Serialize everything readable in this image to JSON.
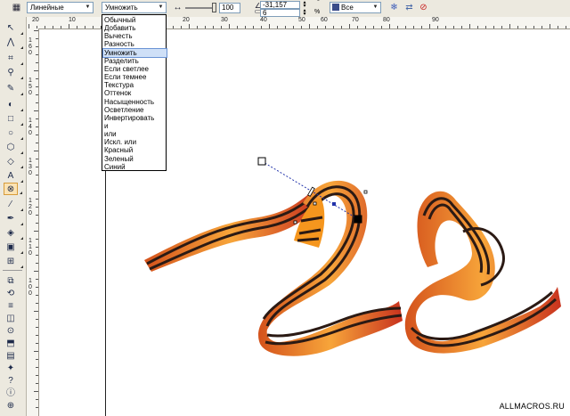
{
  "property_bar": {
    "mode_combo": "Линейные",
    "merge_combo": "Умножить",
    "opacity_value": "100",
    "angle_value": "-31,157",
    "edge_pad_value": "6",
    "edge_pad_unit": "%",
    "target_combo": "Все",
    "opacity_level": 1.0
  },
  "ruler": {
    "h_labels": [
      "20",
      "10",
      "0",
      "10",
      "20",
      "30",
      "40",
      "50",
      "60",
      "70",
      "80",
      "90"
    ],
    "v_labels": [
      "160",
      "150",
      "140",
      "130",
      "120",
      "110",
      "100"
    ]
  },
  "merge_modes": {
    "options": [
      "Обычный",
      "Добавить",
      "Вычесть",
      "Разность",
      "Умножить",
      "Разделить",
      "Если светлее",
      "Если темнее",
      "Текстура",
      "Оттенок",
      "Насыщенность",
      "Осветление",
      "Инвертировать",
      "и",
      "или",
      "Искл. или",
      "Красный",
      "Зеленый",
      "Синий"
    ],
    "selected": "Умножить"
  },
  "tools": [
    "pick-tool",
    "shape-tool",
    "crop-tool",
    "zoom-tool",
    "freehand-tool",
    "smart-fill-tool",
    "rectangle-tool",
    "ellipse-tool",
    "polygon-tool",
    "basic-shapes-tool",
    "text-tool",
    "interactive-transparency-tool",
    "eyedropper-tool",
    "outline-tool",
    "fill-tool",
    "interactive-fill-tool",
    "mesh-fill-tool"
  ],
  "dockers": [
    "object-manager",
    "transform",
    "align",
    "view-manager",
    "lens",
    "shaping",
    "pattern",
    "symbols",
    "hints",
    "properties",
    "zoom"
  ],
  "watermark": "ALLMACROS.RU",
  "colors": {
    "ribbon_orange": "#f5961e",
    "ribbon_dark": "#2b1a14",
    "ribbon_red": "#c8321e",
    "selection_blue": "#2233aa"
  }
}
